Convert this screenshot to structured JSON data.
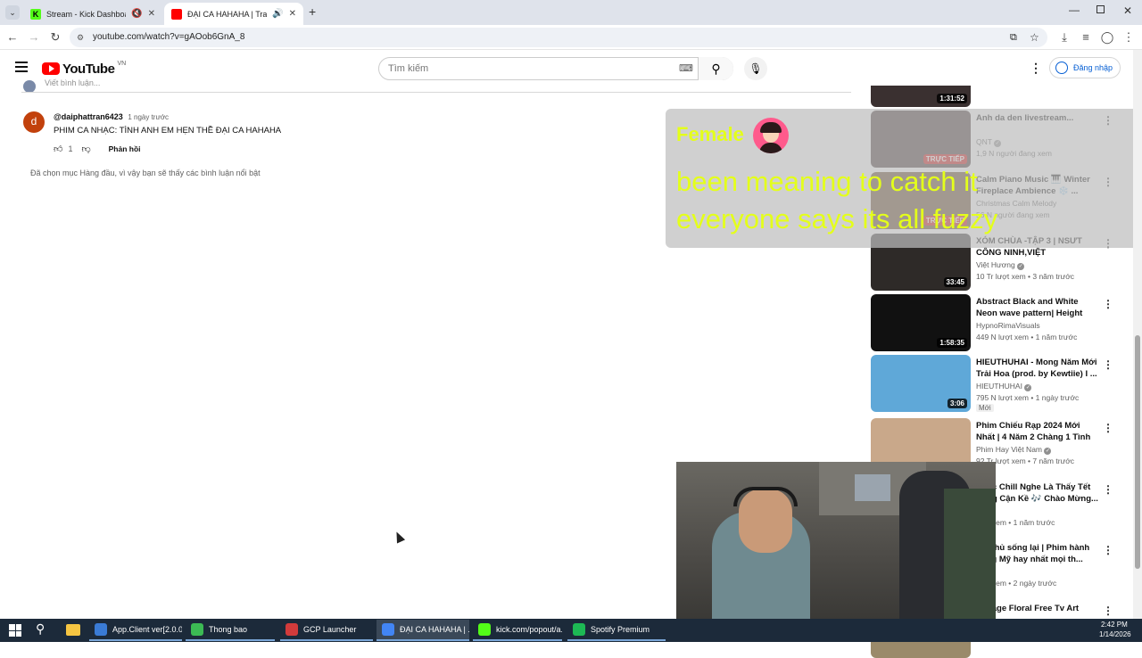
{
  "browser": {
    "tabs": [
      {
        "title": "Stream - Kick Dashboard",
        "favicon_color": "#53fc18",
        "active": false
      },
      {
        "title": "ĐẠI CA HAHAHA | Trailer Ả",
        "favicon_color": "#ff0000",
        "active": true
      }
    ],
    "url": "youtube.com/watch?v=gAOob6GnA_8",
    "window_controls": [
      "minimize-icon",
      "restore-icon",
      "close-icon"
    ]
  },
  "youtube": {
    "logo_text": "YouTube",
    "region": "VN",
    "search_placeholder": "Tìm kiếm",
    "signin_label": "Đăng nhập"
  },
  "comments": {
    "add_comment_placeholder": "Viết bình luận...",
    "items": [
      {
        "avatar_letter": "d",
        "author": "@daiphattran6423",
        "time": "1 ngày trước",
        "text": "PHIM CA NHẠC: TÌNH ANH EM HẸN THỀ ĐẠI CA HAHAHA",
        "likes": "1",
        "reply_label": "Phản hồi"
      }
    ],
    "footer_note": "Đã chọn mục Hàng đầu, vì vậy bạn sẽ thấy các bình luận nổi bật"
  },
  "sidebar": {
    "top_partial_duration": "1:31:52",
    "videos": [
      {
        "title": "Anh da den livestream...",
        "channel": "QNT",
        "verified": true,
        "meta": "1,9 N người đang xem",
        "badge": "TRỰC TIẾP",
        "duration": "",
        "thumb_color": "#3a2a2a"
      },
      {
        "title": "Calm Piano Music 🎹 Winter Fireplace Ambience ❄️ ...",
        "channel": "Christmas Calm Melody",
        "verified": false,
        "meta": "56 N người đang xem",
        "badge": "TRỰC TIẾP",
        "duration": "",
        "thumb_color": "#5a3a1a"
      },
      {
        "title": "XÓM CHÙA -TẬP 3 | NSƯT CÔNG NINH,VIỆT HƯƠNG,THÁ...",
        "channel": "Việt Hương",
        "verified": true,
        "meta": "10 Tr lượt xem • 3 năm trước",
        "badge": "",
        "duration": "33:45",
        "thumb_color": "#2e2a28"
      },
      {
        "title": "Abstract Black and White Neon wave pattern| Height Map ...",
        "channel": "HypnoRimaVisuals",
        "verified": false,
        "meta": "449 N lượt xem • 1 năm trước",
        "badge": "",
        "duration": "1:58:35",
        "thumb_color": "#111111"
      },
      {
        "title": "HIEUTHUHAI - Mong Năm Mới Trải Hoa (prod. by Kewtiie) I ...",
        "channel": "HIEUTHUHAI",
        "verified": true,
        "meta": "795 N lượt xem • 1 ngày trước",
        "badge_new": "Mới",
        "duration": "3:06",
        "thumb_color": "#5fa8d8"
      },
      {
        "title": "Phim Chiếu Rạp 2024 Mới Nhất | 4 Năm 2 Chàng 1 Tình Yêu | ...",
        "channel": "Phim Hay Việt Nam",
        "verified": true,
        "meta": "92 Tr lượt xem • 7 năm trước",
        "badge": "",
        "duration": "",
        "thumb_color": "#c9a88a"
      },
      {
        "title": "Nhạc Chill Nghe Là Thấy Tết Đang Cận Kề 🎶 Chào Mừng...",
        "channel": "",
        "verified": false,
        "meta": "lượt xem • 1 năm trước",
        "badge": "",
        "duration": "",
        "thumb_color": "#8a4a3a"
      },
      {
        "title": "Sát thủ sống lại | Phim hành động Mỹ hay nhất mọi th...",
        "channel": "",
        "verified": false,
        "meta": "lượt xem • 2 ngày trước",
        "badge": "",
        "duration": "",
        "thumb_color": "#444444"
      },
      {
        "title": "Vintage Floral Free Tv Art",
        "channel": "",
        "verified": false,
        "meta": "",
        "badge": "",
        "duration": "",
        "thumb_color": "#9a8a6a"
      }
    ]
  },
  "overlay": {
    "gender_label": "Female",
    "caption_line1": "been meaning to catch it",
    "caption_line2": "everyone says its all fuzzy",
    "caption_color": "#e4ff1a"
  },
  "taskbar": {
    "items": [
      {
        "label": "App.Client ver[2.0.0]",
        "color": "#3a7bd5"
      },
      {
        "label": "Thong bao",
        "color": "#3cba54"
      },
      {
        "label": "GCP Launcher",
        "color": "#d23b3b"
      },
      {
        "label": "ĐẠI CA HAHAHA | ...",
        "color": "#4285f4"
      },
      {
        "label": "kick.com/popout/a...",
        "color": "#53fc18"
      },
      {
        "label": "Spotify Premium",
        "color": "#1db954"
      }
    ],
    "time": "2:42 PM",
    "date": "1/14/2026"
  }
}
